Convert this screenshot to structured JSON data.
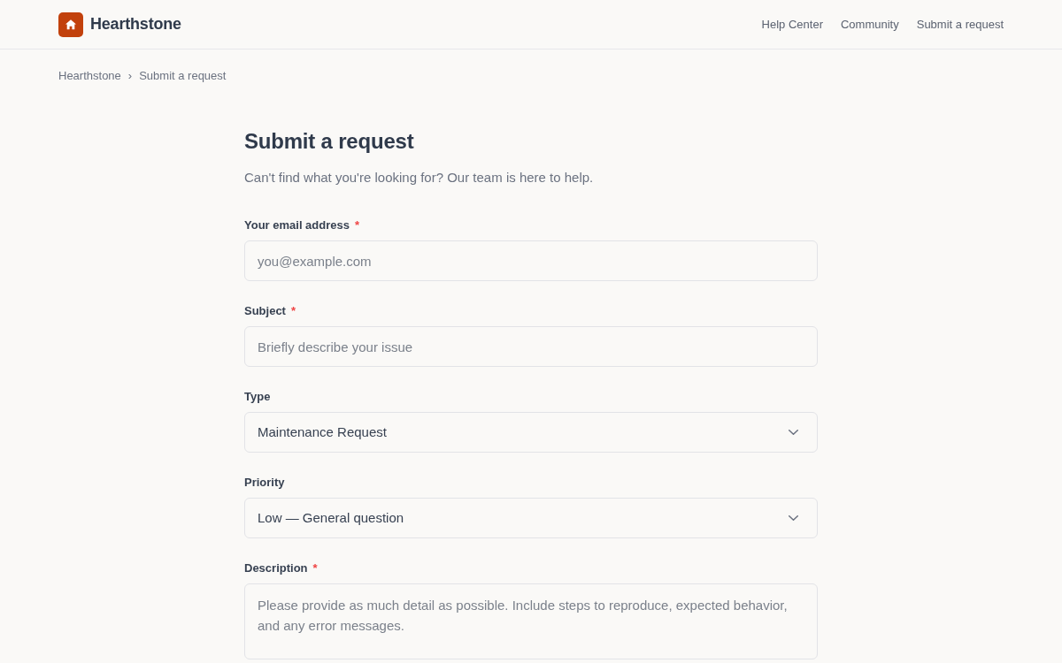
{
  "header": {
    "brand": "Hearthstone",
    "nav": [
      {
        "label": "Help Center"
      },
      {
        "label": "Community"
      },
      {
        "label": "Submit a request"
      }
    ]
  },
  "breadcrumb": {
    "separator": "›",
    "items": [
      {
        "label": "Hearthstone"
      },
      {
        "label": "Submit a request"
      }
    ]
  },
  "form": {
    "title": "Submit a request",
    "subtitle": "Can't find what you're looking for? Our team is here to help.",
    "required_mark": "*",
    "fields": [
      {
        "kind": "input",
        "label": "Your email address",
        "required": true,
        "placeholder": "you@example.com"
      },
      {
        "kind": "input",
        "label": "Subject",
        "required": true,
        "placeholder": "Briefly describe your issue"
      },
      {
        "kind": "select",
        "label": "Type",
        "required": false,
        "value": "Maintenance Request"
      },
      {
        "kind": "select",
        "label": "Priority",
        "required": false,
        "value": "Low — General question"
      },
      {
        "kind": "textarea",
        "label": "Description",
        "required": true,
        "placeholder": "Please provide as much detail as possible. Include steps to reproduce, expected behavior, and any error messages."
      }
    ]
  }
}
